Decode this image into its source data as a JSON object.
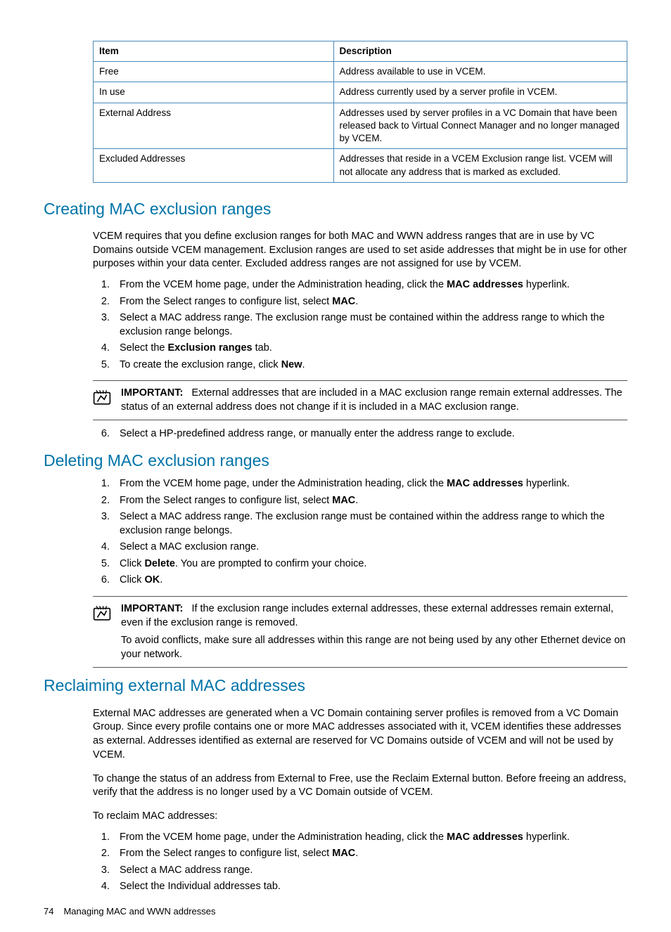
{
  "table": {
    "headers": [
      "Item",
      "Description"
    ],
    "rows": [
      {
        "item": "Free",
        "desc": "Address available to use in VCEM."
      },
      {
        "item": "In use",
        "desc": "Address currently used by a server profile in VCEM."
      },
      {
        "item": "External Address",
        "desc": "Addresses used by server profiles in a VC Domain that have been released back to Virtual Connect Manager and no longer managed by VCEM."
      },
      {
        "item": "Excluded Addresses",
        "desc": "Addresses that reside in a VCEM Exclusion range list. VCEM will not allocate any address that is marked as excluded."
      }
    ]
  },
  "sec1": {
    "title": "Creating MAC exclusion ranges",
    "intro": "VCEM requires that you define exclusion ranges for both MAC and WWN address ranges that are in use by VC Domains outside VCEM management. Exclusion ranges are used to set aside addresses that might be in use for other purposes within your data center. Excluded address ranges are not assigned for use by VCEM.",
    "step1a": "From the VCEM home page, under the Administration heading, click the ",
    "step1b": "MAC addresses",
    "step1c": " hyperlink.",
    "step2a": "From the Select ranges to configure list, select ",
    "step2b": "MAC",
    "step2c": ".",
    "step3": "Select a MAC address range. The exclusion range must be contained within the address range to which the exclusion range belongs.",
    "step4a": "Select the ",
    "step4b": "Exclusion ranges",
    "step4c": " tab.",
    "step5a": "To create the exclusion range, click ",
    "step5b": "New",
    "step5c": ".",
    "noteLabel": "IMPORTANT:",
    "noteText": "External addresses that are included in a MAC exclusion range remain external addresses. The status of an external address does not change if it is included in a MAC exclusion range.",
    "step6": "Select a HP-predefined address range, or manually enter the address range to exclude."
  },
  "sec2": {
    "title": "Deleting MAC exclusion ranges",
    "step1a": "From the VCEM home page, under the Administration heading, click the ",
    "step1b": "MAC addresses",
    "step1c": " hyperlink.",
    "step2a": "From the Select ranges to configure list, select ",
    "step2b": "MAC",
    "step2c": ".",
    "step3": "Select a MAC address range. The exclusion range must be contained within the address range to which the exclusion range belongs.",
    "step4": "Select a MAC exclusion range.",
    "step5a": "Click ",
    "step5b": "Delete",
    "step5c": ". You are prompted to confirm your choice.",
    "step6a": "Click ",
    "step6b": "OK",
    "step6c": ".",
    "noteLabel": "IMPORTANT:",
    "noteText1": "If the exclusion range includes external addresses, these external addresses remain external, even if the exclusion range is removed.",
    "noteText2": "To avoid conflicts, make sure all addresses within this range are not being used by any other Ethernet device on your network."
  },
  "sec3": {
    "title": "Reclaiming external MAC addresses",
    "p1": "External MAC addresses are generated when a VC Domain containing server profiles is removed from a VC Domain Group. Since every profile contains one or more MAC addresses associated with it, VCEM identifies these addresses as external. Addresses identified as external are reserved for VC Domains outside of VCEM and will not be used by VCEM.",
    "p2": "To change the status of an address from External to Free, use the Reclaim External button. Before freeing an address, verify that the address is no longer used by a VC Domain outside of VCEM.",
    "p3": "To reclaim MAC addresses:",
    "step1a": "From the VCEM home page, under the Administration heading, click the ",
    "step1b": "MAC addresses",
    "step1c": " hyperlink.",
    "step2a": "From the Select ranges to configure list, select ",
    "step2b": "MAC",
    "step2c": ".",
    "step3": "Select a MAC address range.",
    "step4": "Select the Individual addresses tab."
  },
  "footer": {
    "page": "74",
    "chapter": "Managing MAC and WWN addresses"
  }
}
